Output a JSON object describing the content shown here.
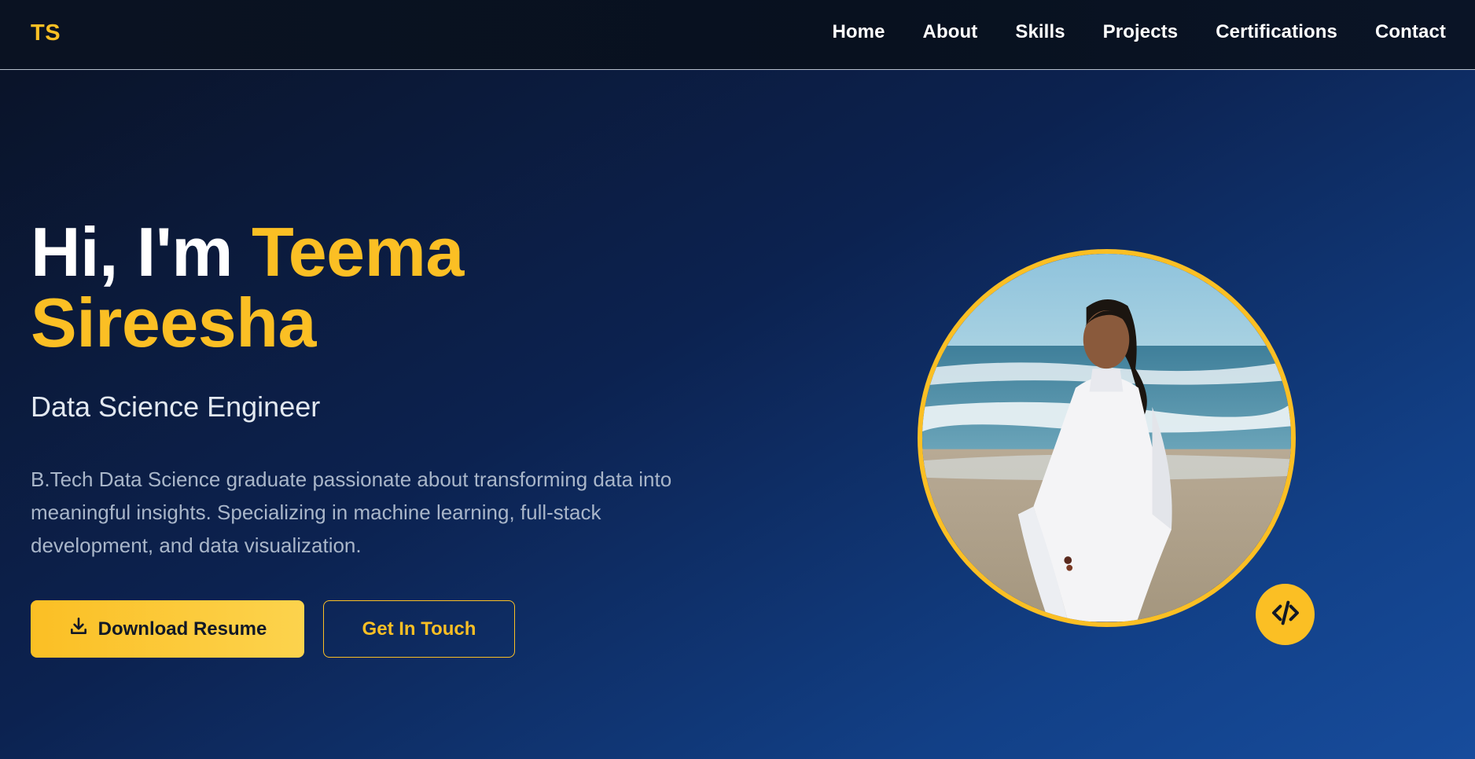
{
  "nav": {
    "logo": "TS",
    "links": [
      "Home",
      "About",
      "Skills",
      "Projects",
      "Certifications",
      "Contact"
    ]
  },
  "hero": {
    "greeting": "Hi, I'm ",
    "first_name": "Teema",
    "last_name": "Sireesha",
    "subtitle": "Data Science Engineer",
    "description": "B.Tech Data Science graduate passionate about transforming data into meaningful insights. Specializing in machine learning, full-stack development, and data visualization.",
    "primary_button": "Download Resume",
    "secondary_button": "Get In Touch"
  },
  "icons": {
    "download": "download-icon",
    "code": "code-icon",
    "photo": "profile-photo"
  },
  "colors": {
    "accent": "#fbbf24",
    "nav_bg": "#08111f",
    "bg_start": "#0a1225",
    "bg_end": "#174c9c",
    "text_muted": "#a9b6c9"
  }
}
